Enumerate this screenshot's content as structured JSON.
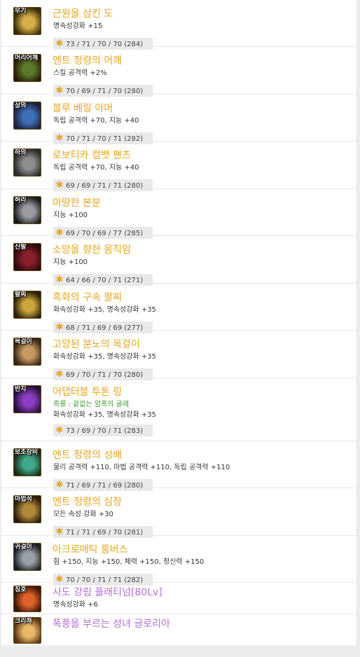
{
  "items": [
    {
      "slot": "무기",
      "name": "근원을 삼킨 도",
      "lines": [
        "명속성강화 +15"
      ],
      "stats": "73 / 71 / 70 / 70 (284)",
      "icon": "weapon-icon",
      "c1": "#d4b04a",
      "c2": "#3a2a08"
    },
    {
      "slot": "머리어깨",
      "name": "엔트 정령의 어깨",
      "lines": [
        "스킬 공격력 +2%"
      ],
      "stats": "70 / 69 / 71 / 70 (280)",
      "icon": "shoulder-icon",
      "c1": "#5b7a2a",
      "c2": "#2a1a06"
    },
    {
      "slot": "상의",
      "name": "블루 베릴 아머",
      "lines": [
        "독립 공격력 +70, 지능 +40"
      ],
      "stats": "70 / 71 / 70 / 71 (282)",
      "icon": "top-armor-icon",
      "c1": "#3f6fb8",
      "c2": "#1c2238"
    },
    {
      "slot": "하의",
      "name": "로보티카 컴뱃 팬츠",
      "lines": [
        "독립 공격력 +70, 지능 +40"
      ],
      "stats": "69 / 69 / 71 / 71 (280)",
      "icon": "pants-icon",
      "c1": "#8d8d8d",
      "c2": "#2a2a2a"
    },
    {
      "slot": "허리",
      "name": "마땅한 본분",
      "lines": [
        "지능 +100"
      ],
      "stats": "69 / 70 / 69 / 77 (285)",
      "icon": "belt-icon",
      "c1": "#9a9aa0",
      "c2": "#1a1a1e"
    },
    {
      "slot": "신발",
      "name": "소망을 향한 움직임",
      "lines": [
        "지능 +100"
      ],
      "stats": "64 / 66 / 70 / 71 (271)",
      "icon": "shoes-icon",
      "c1": "#8a1f2a",
      "c2": "#2a0a0e"
    },
    {
      "slot": "팔찌",
      "name": "흑화의 구속 팔찌",
      "lines": [
        "화속성강화 +35, 명속성강화 +35"
      ],
      "stats": "68 / 71 / 69 / 69 (277)",
      "icon": "bracelet-icon",
      "c1": "#c9a53c",
      "c2": "#2a1f08"
    },
    {
      "slot": "목걸이",
      "name": "고양된 분노의 목걸이",
      "lines": [
        "화속성강화 +35, 명속성강화 +35"
      ],
      "stats": "69 / 70 / 71 / 70 (280)",
      "icon": "necklace-icon",
      "c1": "#c79a62",
      "c2": "#3a2414"
    },
    {
      "slot": "반지",
      "name": "어댑터블 투톤 링",
      "lines": [
        "흑룡 : 끝없는 암흑의 굴레",
        "화속성강화 +35, 명속성강화 +35"
      ],
      "set": true,
      "stats": "73 / 69 / 70 / 71 (283)",
      "icon": "ring-icon",
      "c1": "#8a3fc0",
      "c2": "#2a0c3a"
    },
    {
      "slot": "보조장비",
      "name": "엔트 정령의 성배",
      "lines": [
        "물리 공격력 +110, 마법 공격력 +110, 독립 공격력 +110"
      ],
      "stats": "71 / 69 / 71 / 69 (280)",
      "icon": "grail-icon",
      "c1": "#3fa88a",
      "c2": "#1a2a12"
    },
    {
      "slot": "마법석",
      "name": "엔트 정령의 심장",
      "lines": [
        "모든 속성 강화 +30"
      ],
      "stats": "71 / 71 / 69 / 70 (281)",
      "icon": "magic-stone-icon",
      "c1": "#b08a3a",
      "c2": "#2a1a0a"
    },
    {
      "slot": "귀걸이",
      "name": "아크로매틱 룸버스",
      "lines": [
        "힘 +150, 지능 +150, 체력 +150, 정신력 +150"
      ],
      "stats": "70 / 70 / 71 / 71 (282)",
      "icon": "earring-icon",
      "c1": "#9aa0a8",
      "c2": "#1e2026"
    },
    {
      "slot": "칭호",
      "name": "사도 강림 플래티넘[80Lv]",
      "lines": [
        "명속성강화 +6"
      ],
      "purple": true,
      "stats": "",
      "icon": "title-icon",
      "c1": "#e0612a",
      "c2": "#3a1608"
    },
    {
      "slot": "크리쳐",
      "name": "폭풍을 부르는 성녀 글로리아",
      "lines": [],
      "purple": true,
      "stats": "",
      "icon": "creature-icon",
      "c1": "#e8b868",
      "c2": "#5a3410"
    }
  ]
}
